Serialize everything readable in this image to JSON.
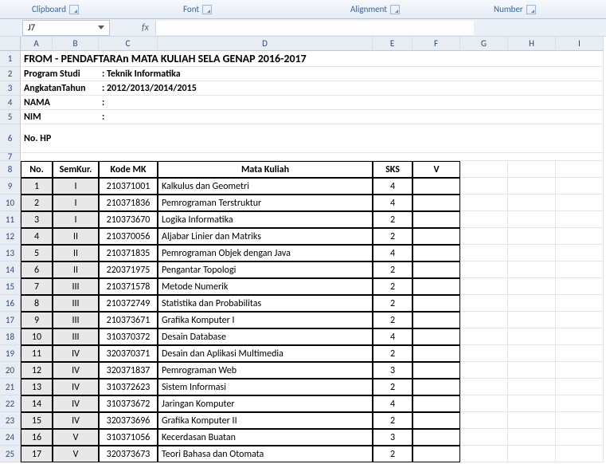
{
  "ribbon": {
    "clipboard": "Clipboard",
    "font": "Font",
    "alignment": "Alignment",
    "number": "Number"
  },
  "namebox": "J7",
  "fx": "fx",
  "cols": [
    "A",
    "B",
    "C",
    "D",
    "E",
    "F",
    "G",
    "H",
    "I"
  ],
  "title": "FROM - PENDAFTARAn MATA KULIAH SELA GENAP 2016-2017",
  "info": {
    "program_label": "Program Studi",
    "program_value": ": Teknik Informatika",
    "angkatan_label": "AngkatanTahun",
    "angkatan_value": ": 2012/2013/2014/2015",
    "nama_label": "NAMA",
    "nama_value": ":",
    "nim_label": "NIM",
    "nim_value": ":",
    "hp_label": "No. HP"
  },
  "headers": {
    "no": "No.",
    "semkur": "SemKur.",
    "kode": "Kode MK",
    "mk": "Mata Kuliah",
    "sks": "SKS",
    "v": "V"
  },
  "rows": [
    {
      "no": "1",
      "sem": "I",
      "kode": "210371001",
      "mk": "Kalkulus dan Geometri",
      "sks": "4"
    },
    {
      "no": "2",
      "sem": "I",
      "kode": "210371836",
      "mk": "Pemrograman Terstruktur",
      "sks": "4"
    },
    {
      "no": "3",
      "sem": "I",
      "kode": "210373670",
      "mk": "Logika Informatika",
      "sks": "2"
    },
    {
      "no": "4",
      "sem": "II",
      "kode": "210370056",
      "mk": "Aljabar Linier dan Matriks",
      "sks": "2"
    },
    {
      "no": "5",
      "sem": "II",
      "kode": "210371835",
      "mk": "Pemrograman Objek dengan Java",
      "sks": "4"
    },
    {
      "no": "6",
      "sem": "II",
      "kode": "220371975",
      "mk": "Pengantar Topologi",
      "sks": "2"
    },
    {
      "no": "7",
      "sem": "III",
      "kode": "210371578",
      "mk": "Metode Numerik",
      "sks": "2"
    },
    {
      "no": "8",
      "sem": "III",
      "kode": "210372749",
      "mk": "Statistika dan Probabilitas",
      "sks": "2"
    },
    {
      "no": "9",
      "sem": "III",
      "kode": "210373671",
      "mk": "Grafika Komputer I",
      "sks": "2"
    },
    {
      "no": "10",
      "sem": "III",
      "kode": "310370372",
      "mk": "Desain Database",
      "sks": "4"
    },
    {
      "no": "11",
      "sem": "IV",
      "kode": "320370371",
      "mk": "Desain dan Aplikasi Multimedia",
      "sks": "2"
    },
    {
      "no": "12",
      "sem": "IV",
      "kode": "320371837",
      "mk": "Pemrograman Web",
      "sks": "3"
    },
    {
      "no": "13",
      "sem": "IV",
      "kode": "310372623",
      "mk": "Sistem Informasi",
      "sks": "2"
    },
    {
      "no": "14",
      "sem": "IV",
      "kode": "310373672",
      "mk": "Jaringan Komputer",
      "sks": "4"
    },
    {
      "no": "15",
      "sem": "IV",
      "kode": "320373696",
      "mk": "Grafika Komputer II",
      "sks": "2"
    },
    {
      "no": "16",
      "sem": "V",
      "kode": "310371056",
      "mk": "Kecerdasan Buatan",
      "sks": "3"
    },
    {
      "no": "17",
      "sem": "V",
      "kode": "320373673",
      "mk": "Teori Bahasa dan Otomata",
      "sks": "2"
    }
  ]
}
